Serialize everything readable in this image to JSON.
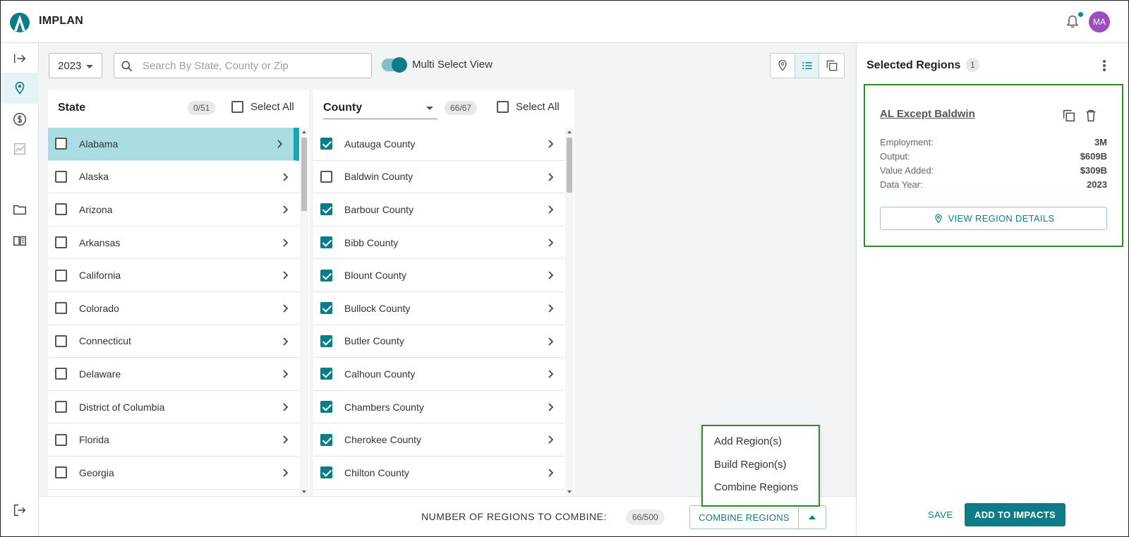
{
  "app": {
    "title": "IMPLAN",
    "avatar_initials": "MA",
    "accent": "#0e7c86"
  },
  "toolbar": {
    "year": "2023",
    "search_placeholder": "Search By State, County or Zip",
    "multi_select_label": "Multi Select View",
    "multi_select_on": true
  },
  "state_panel": {
    "title": "State",
    "count": "0/51",
    "select_all": "Select All",
    "items": [
      {
        "label": "Alabama",
        "checked": false,
        "active": true
      },
      {
        "label": "Alaska",
        "checked": false
      },
      {
        "label": "Arizona",
        "checked": false
      },
      {
        "label": "Arkansas",
        "checked": false
      },
      {
        "label": "California",
        "checked": false
      },
      {
        "label": "Colorado",
        "checked": false
      },
      {
        "label": "Connecticut",
        "checked": false
      },
      {
        "label": "Delaware",
        "checked": false
      },
      {
        "label": "District of Columbia",
        "checked": false
      },
      {
        "label": "Florida",
        "checked": false
      },
      {
        "label": "Georgia",
        "checked": false
      }
    ]
  },
  "county_panel": {
    "dropdown_label": "County",
    "count": "66/67",
    "select_all": "Select All",
    "items": [
      {
        "label": "Autauga County",
        "checked": true
      },
      {
        "label": "Baldwin County",
        "checked": false
      },
      {
        "label": "Barbour County",
        "checked": true
      },
      {
        "label": "Bibb County",
        "checked": true
      },
      {
        "label": "Blount County",
        "checked": true
      },
      {
        "label": "Bullock County",
        "checked": true
      },
      {
        "label": "Butler County",
        "checked": true
      },
      {
        "label": "Calhoun County",
        "checked": true
      },
      {
        "label": "Chambers County",
        "checked": true
      },
      {
        "label": "Cherokee County",
        "checked": true
      },
      {
        "label": "Chilton County",
        "checked": true
      }
    ]
  },
  "bottom_bar": {
    "count_label": "NUMBER OF REGIONS TO COMBINE:",
    "count_value": "66/500",
    "combine_button": "COMBINE REGIONS"
  },
  "combine_menu": {
    "items": [
      "Add Region(s)",
      "Build Region(s)",
      "Combine Regions"
    ]
  },
  "selected_regions": {
    "title": "Selected Regions",
    "count": "1",
    "region": {
      "name": "AL Except Baldwin",
      "stats": [
        {
          "label": "Employment:",
          "value": "3M"
        },
        {
          "label": "Output:",
          "value": "$609B"
        },
        {
          "label": "Value Added:",
          "value": "$309B"
        },
        {
          "label": "Data Year:",
          "value": "2023"
        }
      ],
      "details_button": "VIEW REGION DETAILS"
    },
    "save_label": "SAVE",
    "add_button": "ADD TO IMPACTS"
  }
}
